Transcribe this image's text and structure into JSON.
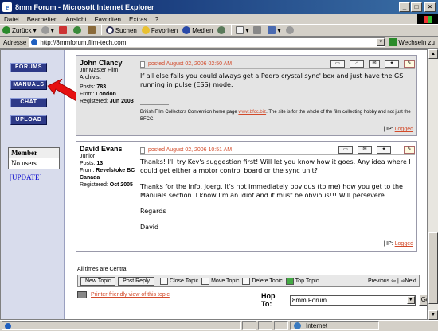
{
  "window": {
    "title": "8mm Forum - Microsoft Internet Explorer"
  },
  "menu": [
    "Datei",
    "Bearbeiten",
    "Ansicht",
    "Favoriten",
    "Extras",
    "?"
  ],
  "toolbar": {
    "back": "Zurück",
    "search": "Suchen",
    "favorites": "Favoriten",
    "media": "Medien"
  },
  "address": {
    "label": "Adresse",
    "url": "http://8mmforum.film-tech.com",
    "go": "Wechseln zu"
  },
  "sidebar": {
    "buttons": [
      "FORUMS",
      "MANUALS",
      "CHAT",
      "UPLOAD"
    ],
    "member_header": "Member",
    "member_value": "No users",
    "update": "[UPDATE]"
  },
  "posts": [
    {
      "author": "John Clancy",
      "role": "Jnr Master Film Archivist",
      "posts": "783",
      "from": "London",
      "registered": "Jun 2003",
      "date": "posted August 02, 2006 02:50 AM",
      "body": [
        "If all else fails you could always get a Pedro crystal sync' box and just have the GS running in pulse (ESS) mode."
      ],
      "sig_divider": "------------------",
      "sig_before": "British Film Collectors Convention home page",
      "sig_link": "www.bfcc.biz",
      "sig_after": ". The site is for the whole of the film collecting hobby and not just the BFCC.",
      "ip_label": "IP:",
      "ip_link": "Logged"
    },
    {
      "author": "David Evans",
      "role": "Junior",
      "posts": "13",
      "from": "Revelstoke BC Canada",
      "registered": "Oct 2005",
      "date": "posted August 02, 2006 10:51 AM",
      "body": [
        "Thanks! I'll try Kev's suggestion first! Will let you know how it goes. Any idea where I could get either a motor control board or the sync unit?",
        "Thanks for the info, Joerg. It's not immediately obvious (to me) how you get to the Manuals section. I know I'm an idiot and it must be obvious!!! Will persevere...",
        "Regards",
        "David"
      ],
      "ip_label": "IP:",
      "ip_link": "Logged"
    }
  ],
  "labels": {
    "posts": "Posts:",
    "from": "From:",
    "registered": "Registered:"
  },
  "footer": {
    "times": "All times are Central",
    "new_topic": "New Topic",
    "post_reply": "Post Reply",
    "close_topic": "Close Topic",
    "move_topic": "Move Topic",
    "delete_topic": "Delete Topic",
    "top_topic": "Top Topic",
    "previous": "Previous",
    "next": "Next",
    "print": "Printer-friendly view of this topic",
    "hop_to": "Hop To:",
    "hop_value": "8mm Forum",
    "go": "Go"
  },
  "status": {
    "zone": "Internet"
  }
}
